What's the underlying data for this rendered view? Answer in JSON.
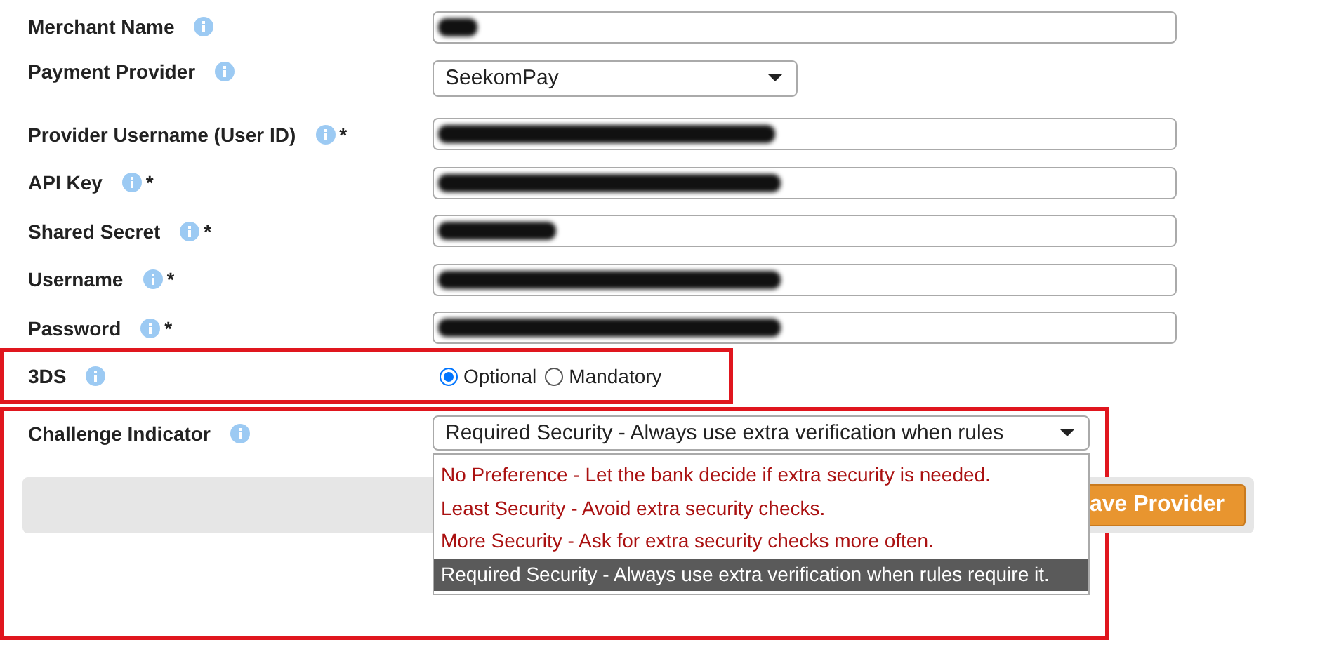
{
  "fields": [
    {
      "label": "Merchant Name",
      "kind": "redacted"
    },
    {
      "label": "Payment Provider",
      "kind": "select",
      "value": "SeekomPay"
    },
    {
      "label": "Provider Username (User ID)",
      "kind": "redacted",
      "marker": "*"
    },
    {
      "label": "API Key",
      "kind": "redacted",
      "marker": "*"
    },
    {
      "label": "Shared Secret",
      "kind": "redacted",
      "marker": "*"
    },
    {
      "label": "Username",
      "kind": "redacted",
      "marker": "*"
    },
    {
      "label": "Password",
      "kind": "redacted",
      "marker": "*"
    }
  ],
  "three_ds": {
    "label": "3DS",
    "options": [
      {
        "label": "Optional",
        "selected": true
      },
      {
        "label": "Mandatory",
        "selected": false
      }
    ]
  },
  "challenge_indicator": {
    "label": "Challenge Indicator",
    "value": "Required Security - Always use extra verification when rules",
    "options": [
      {
        "label": "No Preference - Let the bank decide if extra security is needed.",
        "selected": false
      },
      {
        "label": "Least Security - Avoid extra security checks.",
        "selected": false
      },
      {
        "label": "More Security - Ask for extra security checks more often.",
        "selected": false
      },
      {
        "label": "Required Security - Always use extra verification when rules require it.",
        "selected": true
      }
    ]
  },
  "save_button": {
    "label": "ave Provider"
  }
}
